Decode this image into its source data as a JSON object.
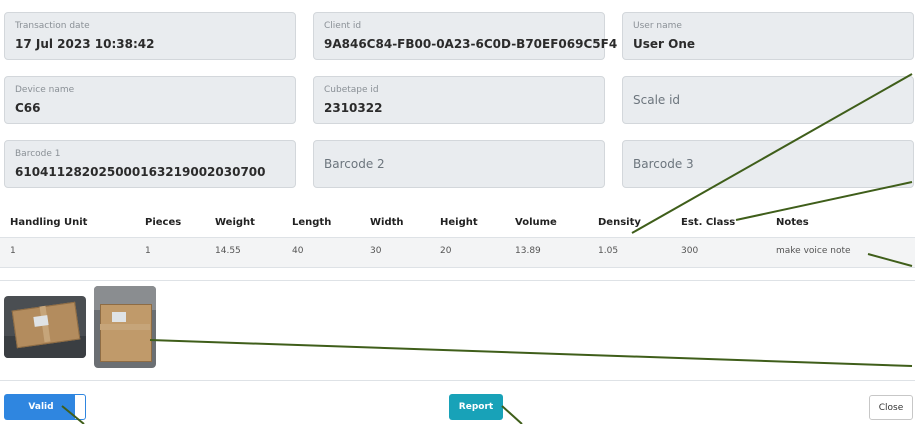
{
  "fields": {
    "transaction_date": {
      "label": "Transaction date",
      "value": "17 Jul 2023 10:38:42"
    },
    "client_id": {
      "label": "Client id",
      "value": "9A846C84-FB00-0A23-6C0D-B70EF069C5F4"
    },
    "user_name": {
      "label": "User name",
      "value": "User One"
    },
    "device_name": {
      "label": "Device name",
      "value": "C66"
    },
    "cubetape_id": {
      "label": "Cubetape id",
      "value": "2310322"
    },
    "scale_id": {
      "placeholder": "Scale id"
    },
    "barcode1": {
      "label": "Barcode 1",
      "value": "610411282025000163219002030700"
    },
    "barcode2": {
      "placeholder": "Barcode 2"
    },
    "barcode3": {
      "placeholder": "Barcode 3"
    }
  },
  "table": {
    "headers": [
      "Handling Unit",
      "Pieces",
      "Weight",
      "Length",
      "Width",
      "Height",
      "Volume",
      "Density",
      "Est. Class",
      "Notes"
    ],
    "rows": [
      [
        "1",
        "1",
        "14.55",
        "40",
        "30",
        "20",
        "13.89",
        "1.05",
        "300",
        "make voice note"
      ]
    ]
  },
  "images": [
    "box-photo-1",
    "box-photo-2"
  ],
  "buttons": {
    "valid": "Valid",
    "report": "Report",
    "close": "Close"
  },
  "colors": {
    "valid": "#2f86e0",
    "report": "#18a2b8",
    "annotation_line": "#3f5e1a"
  }
}
